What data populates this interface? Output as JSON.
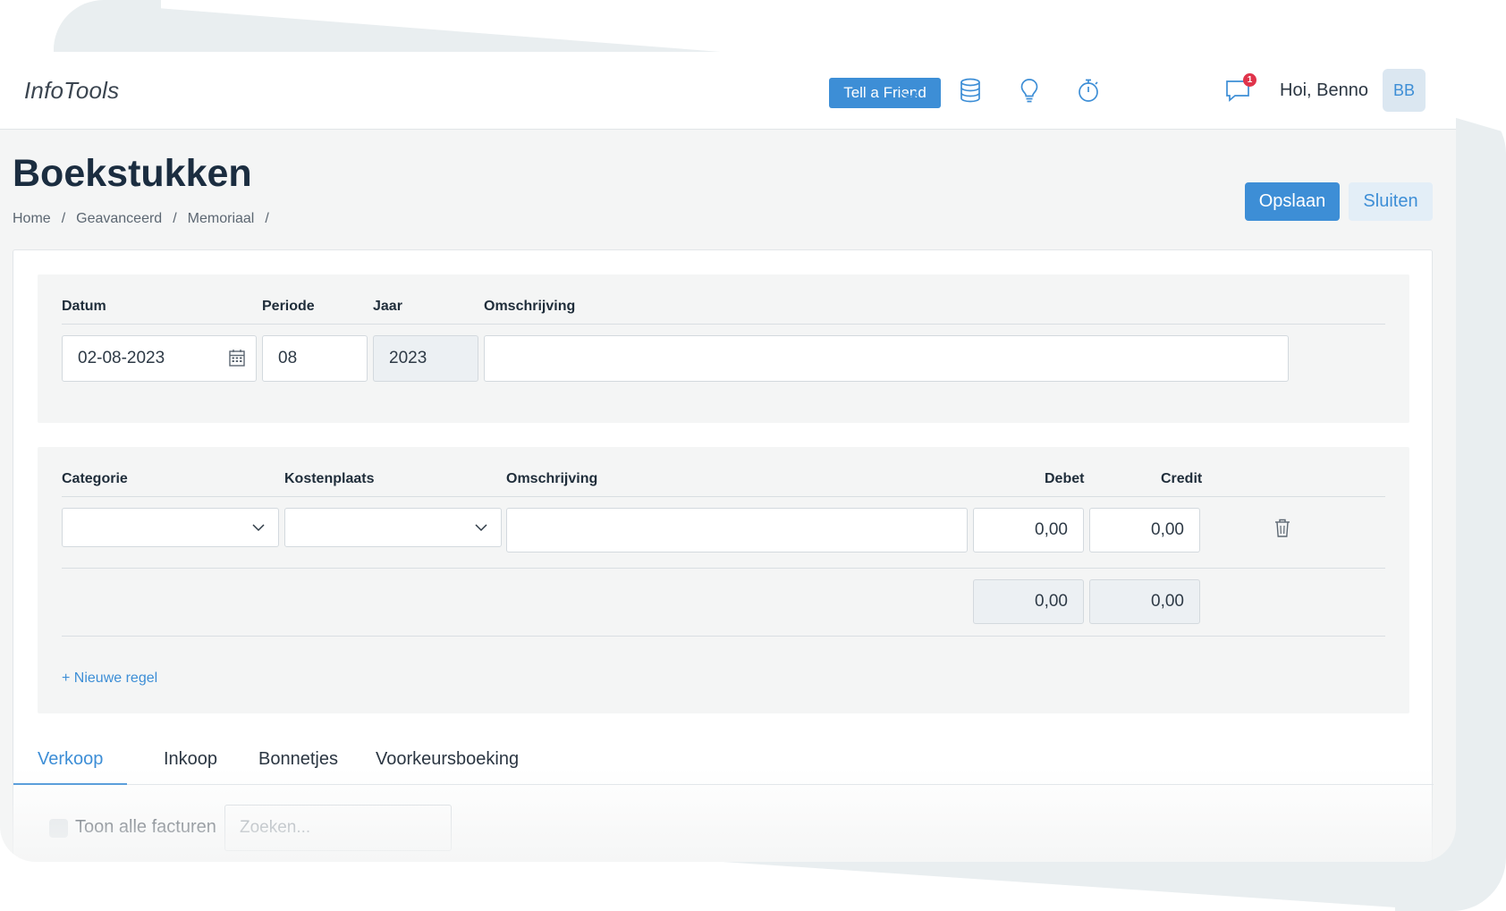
{
  "app": {
    "name": "InfoTools"
  },
  "topbar": {
    "tell_a_friend": "Tell a Friend",
    "icons": [
      "search-icon",
      "database-icon",
      "lightbulb-icon",
      "stopwatch-icon",
      "chat-icon"
    ],
    "notification_count": "1",
    "greeting": "Hoi, Benno",
    "avatar_initials": "BB"
  },
  "page": {
    "title": "Boekstukken",
    "breadcrumb": [
      "Home",
      "Geavanceerd",
      "Memoriaal"
    ],
    "breadcrumb_sep": "/",
    "save_label": "Opslaan",
    "close_label": "Sluiten"
  },
  "header_form": {
    "labels": {
      "datum": "Datum",
      "periode": "Periode",
      "jaar": "Jaar",
      "omschrijving": "Omschrijving"
    },
    "values": {
      "datum": "02-08-2023",
      "periode": "08",
      "jaar": "2023",
      "omschrijving": ""
    }
  },
  "lines": {
    "labels": {
      "categorie": "Categorie",
      "kostenplaats": "Kostenplaats",
      "omschrijving": "Omschrijving",
      "debet": "Debet",
      "credit": "Credit"
    },
    "rows": [
      {
        "categorie": "",
        "kostenplaats": "",
        "omschrijving": "",
        "debet": "0,00",
        "credit": "0,00"
      }
    ],
    "totals": {
      "debet": "0,00",
      "credit": "0,00"
    },
    "new_line": "+ Nieuwe regel"
  },
  "tabs": [
    {
      "label": "Verkoop",
      "active": true
    },
    {
      "label": "Inkoop",
      "active": false
    },
    {
      "label": "Bonnetjes",
      "active": false
    },
    {
      "label": "Voorkeursboeking",
      "active": false
    }
  ],
  "filter": {
    "show_all_label": "Toon alle facturen",
    "search_placeholder": "Zoeken..."
  },
  "colors": {
    "accent": "#3d8ed6",
    "title": "#1b2d40",
    "badge": "#e0344b"
  }
}
